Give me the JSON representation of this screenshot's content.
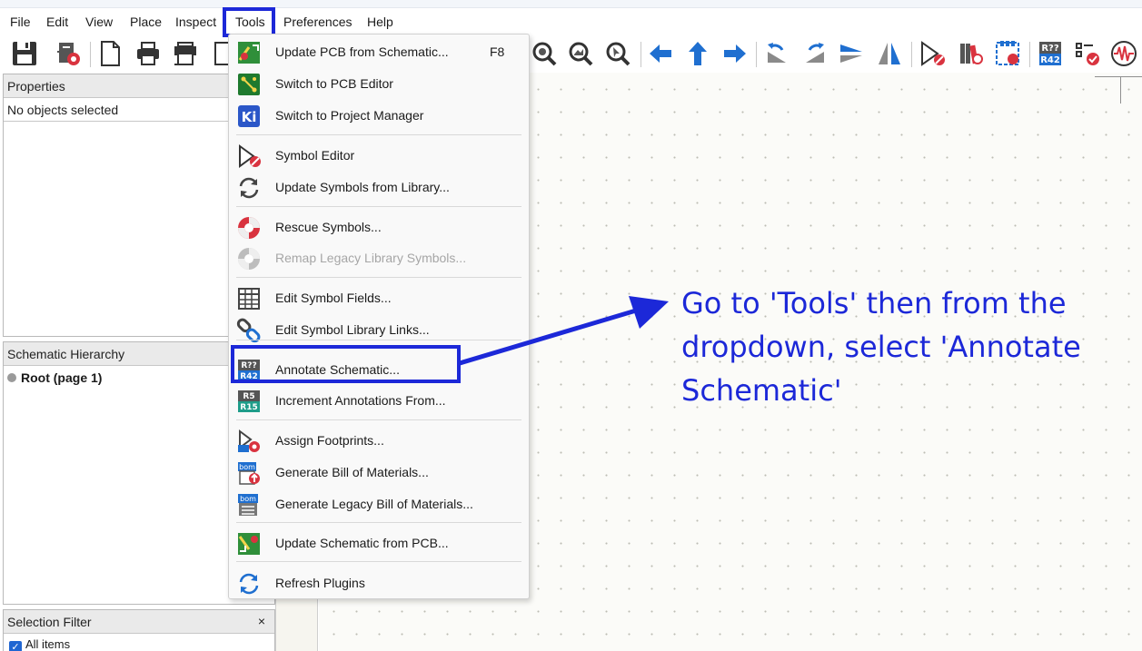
{
  "menubar": {
    "items": [
      {
        "label": "File"
      },
      {
        "label": "Edit"
      },
      {
        "label": "View"
      },
      {
        "label": "Place"
      },
      {
        "label": "Inspect"
      },
      {
        "label": "Tools"
      },
      {
        "label": "Preferences"
      },
      {
        "label": "Help"
      }
    ],
    "active": "Tools"
  },
  "toolbar": {
    "icons": [
      "save-icon",
      "schematic-setup-icon",
      "page-settings-icon",
      "print-icon",
      "plot-icon",
      "paste-icon",
      "zoom-redraw-icon",
      "zoom-in-icon",
      "zoom-out-icon",
      "zoom-fit-icon",
      "zoom-objects-icon",
      "zoom-selection-icon",
      "navigate-back-icon",
      "navigate-up-icon",
      "navigate-forward-icon",
      "rotate-ccw-icon",
      "rotate-cw-icon",
      "mirror-vertical-icon",
      "mirror-horizontal-icon",
      "symbol-editor-icon",
      "symbol-library-browser-icon",
      "footprint-assign-icon",
      "annotate-icon",
      "erc-icon",
      "simulator-icon"
    ]
  },
  "properties_panel": {
    "title": "Properties",
    "status": "No objects selected"
  },
  "hierarchy_panel": {
    "title": "Schematic Hierarchy",
    "root": "Root (page 1)"
  },
  "selection_filter": {
    "title": "Selection Filter",
    "close_glyph": "×",
    "all_items": "All items"
  },
  "tools_menu": {
    "items": [
      {
        "label": "Update PCB from Schematic...",
        "shortcut": "F8",
        "icon": "update-pcb-icon",
        "enabled": true
      },
      {
        "label": "Switch to PCB Editor",
        "icon": "pcb-editor-icon",
        "enabled": true
      },
      {
        "label": "Switch to Project Manager",
        "icon": "kicad-project-icon",
        "enabled": true
      },
      {
        "label": "Symbol Editor",
        "icon": "symbol-editor-icon",
        "enabled": true
      },
      {
        "label": "Update Symbols from Library...",
        "icon": "refresh-icon",
        "enabled": true
      },
      {
        "label": "Rescue Symbols...",
        "icon": "rescue-icon",
        "enabled": true
      },
      {
        "label": "Remap Legacy Library Symbols...",
        "icon": "remap-icon",
        "enabled": false
      },
      {
        "label": "Edit Symbol Fields...",
        "icon": "table-icon",
        "enabled": true
      },
      {
        "label": "Edit Symbol Library Links...",
        "icon": "link-icon",
        "enabled": true
      },
      {
        "label": "Annotate Schematic...",
        "icon": "annotate-icon",
        "enabled": true
      },
      {
        "label": "Increment Annotations From...",
        "icon": "increment-annotations-icon",
        "enabled": true
      },
      {
        "label": "Assign Footprints...",
        "icon": "footprint-icon",
        "enabled": true
      },
      {
        "label": "Generate Bill of Materials...",
        "icon": "bom-icon",
        "enabled": true
      },
      {
        "label": "Generate Legacy Bill of Materials...",
        "icon": "bom-legacy-icon",
        "enabled": true
      },
      {
        "label": "Update Schematic from PCB...",
        "icon": "update-schematic-icon",
        "enabled": true
      },
      {
        "label": "Refresh Plugins",
        "icon": "refresh-icon",
        "enabled": true
      }
    ]
  },
  "icon_text": {
    "annotate_top": "R??",
    "annotate_bottom": "R42",
    "increment_top": "R5",
    "increment_bottom": "R15",
    "bom": "bom",
    "kicad": "Ki"
  },
  "annotation": {
    "instruction": "Go to 'Tools' then from the dropdown, select 'Annotate Schematic'",
    "highlight_color": "#1c28d8"
  }
}
